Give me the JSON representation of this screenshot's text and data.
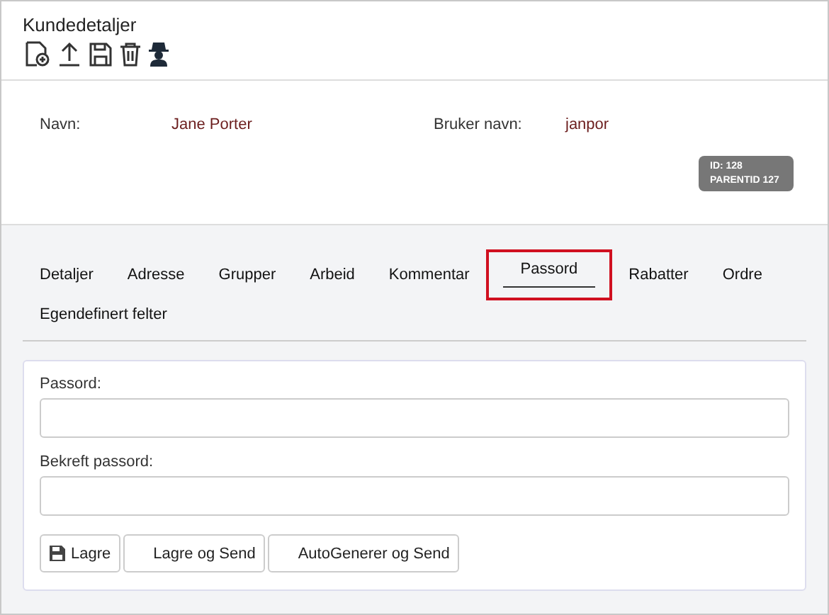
{
  "title": "Kundedetaljer",
  "fields": [
    {
      "label": "Navn:",
      "value": "Jane Porter"
    },
    {
      "label": "Bruker navn:",
      "value": "janpor"
    }
  ],
  "badge": [
    "ID: 128",
    "PARENTID 127"
  ],
  "tabs": [
    {
      "label": "Detaljer",
      "selected": false
    },
    {
      "label": "Adresse",
      "selected": false
    },
    {
      "label": "Grupper",
      "selected": false
    },
    {
      "label": "Arbeid",
      "selected": false
    },
    {
      "label": "Kommentar",
      "selected": false
    },
    {
      "label": "Passord",
      "selected": true
    },
    {
      "label": "Rabatter",
      "selected": false
    },
    {
      "label": "Ordre",
      "selected": false
    },
    {
      "label": "Egendefinert felter",
      "selected": false
    }
  ],
  "inputs": [
    {
      "label": "Passord:"
    },
    {
      "label": "Bekreft passord:"
    }
  ],
  "buttons": [
    {
      "label": "Lagre",
      "kind": "save"
    },
    {
      "label": "Lagre og Send",
      "kind": "plain"
    },
    {
      "label": "AutoGenerer og Send",
      "kind": "plain"
    }
  ]
}
